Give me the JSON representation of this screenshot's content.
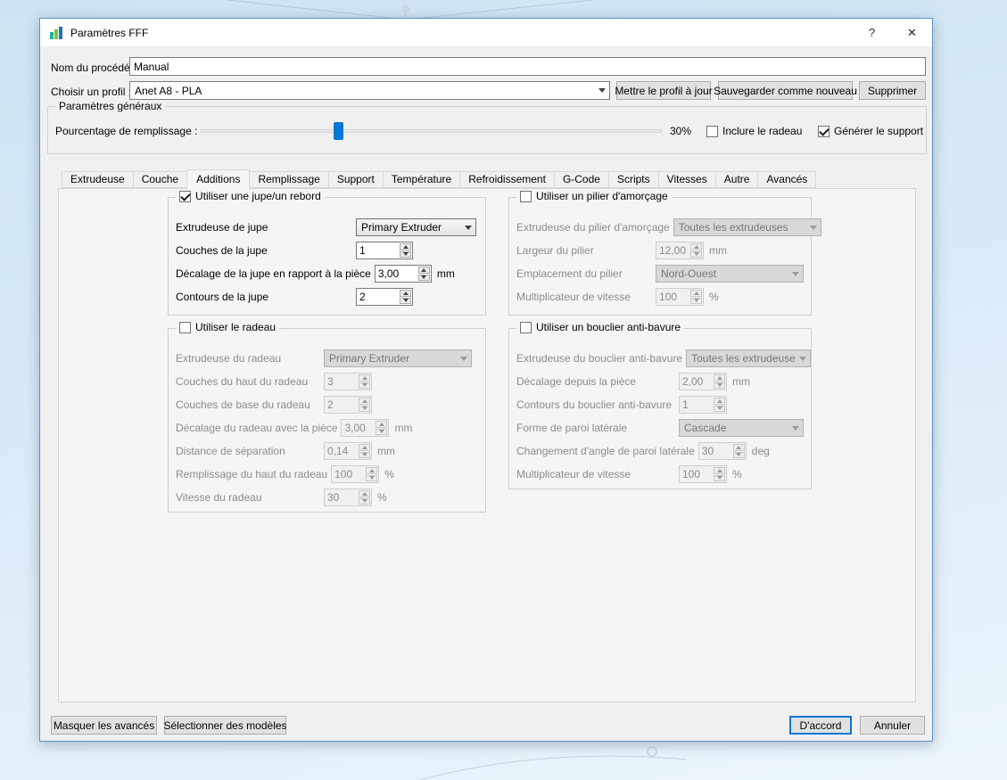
{
  "colors": {
    "accent": "#0078d7",
    "app_icon_bars": [
      "#19b49c",
      "#7cbf44",
      "#1c75bc"
    ]
  },
  "window": {
    "title": "Paramètres FFF",
    "help_glyph": "?",
    "close_glyph": "✕"
  },
  "header": {
    "process_name_label": "Nom du procédé :",
    "process_name_value": "Manual",
    "profile_label": "Choisir un profil :",
    "profile_value": "Anet A8 - PLA",
    "update_profile_button": "Mettre le profil à jour",
    "save_as_new_button": "Sauvegarder comme nouveau",
    "delete_button": "Supprimer"
  },
  "general": {
    "group_title": "Paramètres généraux",
    "infill_label": "Pourcentage de remplissage :",
    "infill_percent": 30,
    "infill_value_text": "30%",
    "include_raft_label": "Inclure le radeau",
    "include_raft_checked": false,
    "generate_support_label": "Générer le support",
    "generate_support_checked": true
  },
  "tabs": [
    {
      "label": "Extrudeuse",
      "selected": false
    },
    {
      "label": "Couche",
      "selected": false
    },
    {
      "label": "Additions",
      "selected": true
    },
    {
      "label": "Remplissage",
      "selected": false
    },
    {
      "label": "Support",
      "selected": false
    },
    {
      "label": "Température",
      "selected": false
    },
    {
      "label": "Refroidissement",
      "selected": false
    },
    {
      "label": "G-Code",
      "selected": false
    },
    {
      "label": "Scripts",
      "selected": false
    },
    {
      "label": "Vitesses",
      "selected": false
    },
    {
      "label": "Autre",
      "selected": false
    },
    {
      "label": "Avancés",
      "selected": false
    }
  ],
  "groups": {
    "skirt": {
      "title": "Utiliser une jupe/un rebord",
      "checked": true,
      "rows": [
        {
          "label": "Extrudeuse de jupe",
          "control": "select",
          "value": "Primary Extruder"
        },
        {
          "label": "Couches de la jupe",
          "control": "spin",
          "value": "1"
        },
        {
          "label": "Décalage de la jupe en rapport à la pièce",
          "control": "spin",
          "value": "3,00",
          "unit": "mm"
        },
        {
          "label": "Contours de la jupe",
          "control": "spin",
          "value": "2"
        }
      ]
    },
    "prime_pillar": {
      "title": "Utiliser un pilier d'amorçage",
      "checked": false,
      "rows": [
        {
          "label": "Extrudeuse du pilier d'amorçage",
          "control": "select",
          "value": "Toutes les extrudeuses"
        },
        {
          "label": "Largeur du pilier",
          "control": "spin",
          "value": "12,00",
          "unit": "mm"
        },
        {
          "label": "Emplacement du pilier",
          "control": "select",
          "value": "Nord-Ouest"
        },
        {
          "label": "Multiplicateur de vitesse",
          "control": "spin",
          "value": "100",
          "unit": "%"
        }
      ]
    },
    "raft": {
      "title": "Utiliser le radeau",
      "checked": false,
      "rows": [
        {
          "label": "Extrudeuse du radeau",
          "control": "select",
          "value": "Primary Extruder"
        },
        {
          "label": "Couches du haut du radeau",
          "control": "spin",
          "value": "3"
        },
        {
          "label": "Couches de base du radeau",
          "control": "spin",
          "value": "2"
        },
        {
          "label": "Décalage du radeau avec la pièce",
          "control": "spin",
          "value": "3,00",
          "unit": "mm"
        },
        {
          "label": "Distance de séparation",
          "control": "spin",
          "value": "0,14",
          "unit": "mm"
        },
        {
          "label": "Remplissage du haut du radeau",
          "control": "spin",
          "value": "100",
          "unit": "%"
        },
        {
          "label": "Vitesse du radeau",
          "control": "spin",
          "value": "30",
          "unit": "%"
        }
      ]
    },
    "ooze_shield": {
      "title": "Utiliser un bouclier anti-bavure",
      "checked": false,
      "rows": [
        {
          "label": "Extrudeuse du bouclier anti-bavure",
          "control": "select",
          "value": "Toutes les extrudeuses"
        },
        {
          "label": "Décalage depuis la pièce",
          "control": "spin",
          "value": "2,00",
          "unit": "mm"
        },
        {
          "label": "Contours du bouclier anti-bavure",
          "control": "spin",
          "value": "1"
        },
        {
          "label": "Forme de paroi latérale",
          "control": "select",
          "value": "Cascade"
        },
        {
          "label": "Changement d'angle de paroi latérale",
          "control": "spin",
          "value": "30",
          "unit": "deg"
        },
        {
          "label": "Multiplicateur de vitesse",
          "control": "spin",
          "value": "100",
          "unit": "%"
        }
      ]
    }
  },
  "footer": {
    "hide_advanced_button": "Masquer les avancés",
    "select_models_button": "Sélectionner des modèles",
    "ok_button": "D'accord",
    "cancel_button": "Annuler"
  }
}
